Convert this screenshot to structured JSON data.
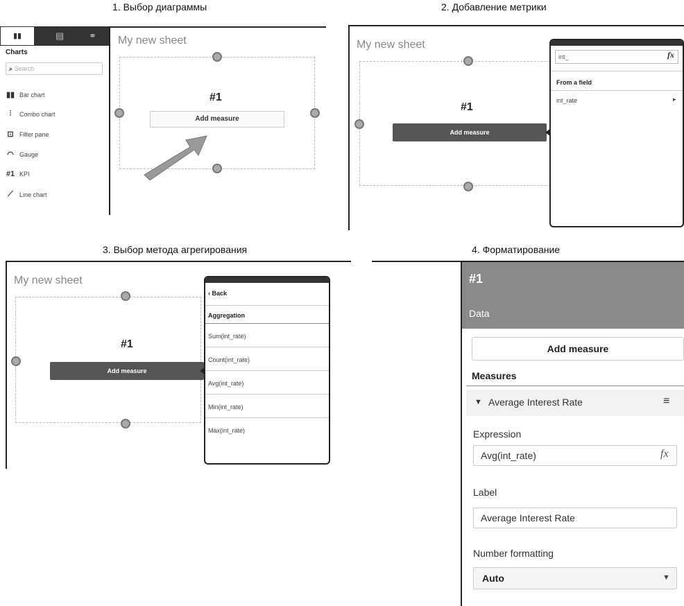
{
  "captions": {
    "c1": "1. Выбор диаграммы",
    "c2": "2. Добавление метрики",
    "c3": "3. Выбор метода агрегирования",
    "c4": "4. Форматирование"
  },
  "panel1": {
    "sheet_title": "My new sheet",
    "charts_heading": "Charts",
    "search_placeholder": "Search",
    "items": [
      {
        "icon": "bar-chart-icon",
        "glyph": "▮▮",
        "label": "Bar chart"
      },
      {
        "icon": "combo-chart-icon",
        "glyph": "⫶",
        "label": "Combo chart"
      },
      {
        "icon": "filter-pane-icon",
        "glyph": "⊡",
        "label": "Filter pane"
      },
      {
        "icon": "gauge-icon",
        "glyph": "◠",
        "label": "Gauge"
      },
      {
        "icon": "kpi-icon",
        "glyph": "#1",
        "label": "KPI"
      },
      {
        "icon": "line-chart-icon",
        "glyph": "⟋",
        "label": "Line chart"
      }
    ],
    "kpi": "#1",
    "add_measure": "Add measure"
  },
  "panel2": {
    "sheet_title": "My new sheet",
    "kpi": "#1",
    "add_measure": "Add measure",
    "search_value": "int_",
    "fx": "fx",
    "from_field": "From a field",
    "field": "int_rate"
  },
  "panel3": {
    "sheet_title": "My new sheet",
    "kpi": "#1",
    "add_measure": "Add measure",
    "back": "Back",
    "aggregation": "Aggregation",
    "options": [
      "Sum(int_rate)",
      "Count(int_rate)",
      "Avg(int_rate)",
      "Min(int_rate)",
      "Max(int_rate)"
    ]
  },
  "panel4": {
    "kpi": "#1",
    "data": "Data",
    "add_measure": "Add measure",
    "measures": "Measures",
    "measure_name": "Average Interest Rate",
    "expression_label": "Expression",
    "expression_value": "Avg(int_rate)",
    "fx": "fx",
    "label_label": "Label",
    "label_value": "Average Interest Rate",
    "number_formatting": "Number formatting",
    "format_value": "Auto"
  }
}
